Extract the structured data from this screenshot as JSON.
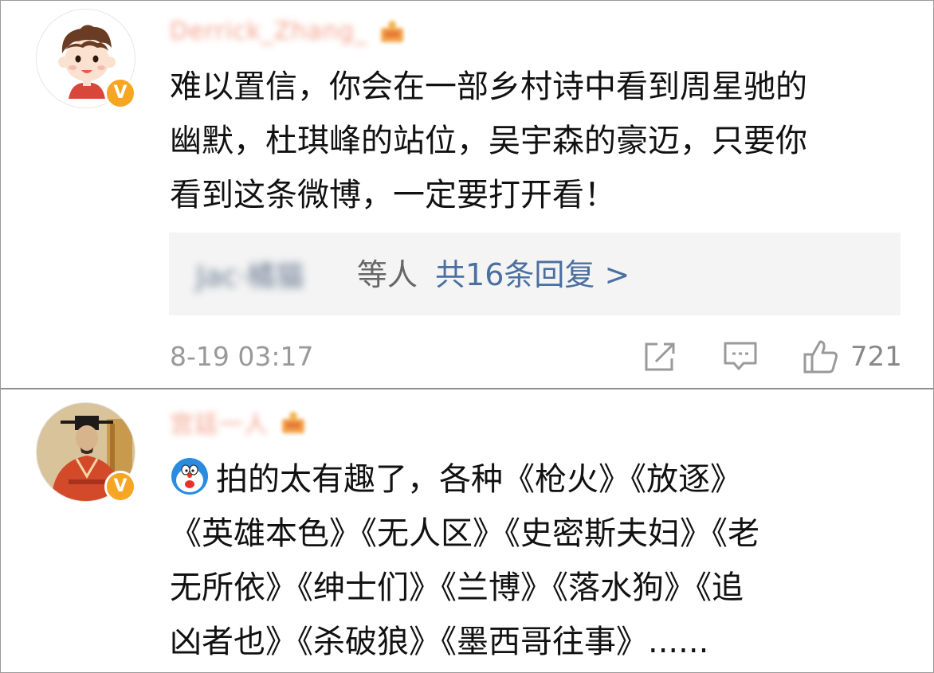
{
  "comments": [
    {
      "username": "Derrick_Zhang_",
      "text_lines": [
        "难以置信，你会在一部乡村诗中看到周星驰的",
        "幽默，杜琪峰的站位，吴宇森的豪迈，只要你",
        "看到这条微博，一定要打开看！"
      ],
      "reply_users": "Jac·橘猫",
      "reply_suffix": "等人",
      "reply_link": "共16条回复 >",
      "timestamp": "8-19 03:17",
      "like_count": "721"
    },
    {
      "username": "宫廷一人",
      "text_lines": [
        "拍的太有趣了，各种《枪火》《放逐》",
        "《英雄本色》《无人区》《史密斯夫妇》《老",
        "无所依》《绅士们》《兰博》《落水狗》《追",
        "凶者也》《杀破狼》《墨西哥往事》......"
      ]
    }
  ],
  "icons": {
    "verified": "v-badge-icon",
    "crown": "crown-icon",
    "share": "share-icon",
    "comment": "comment-icon",
    "like": "thumbs-up-icon",
    "emoji": "doraemon-icon"
  },
  "colors": {
    "badge": "#f6a623",
    "link": "#4a6fa0",
    "meta_text": "#999999",
    "reply_bg": "#f4f4f4"
  }
}
